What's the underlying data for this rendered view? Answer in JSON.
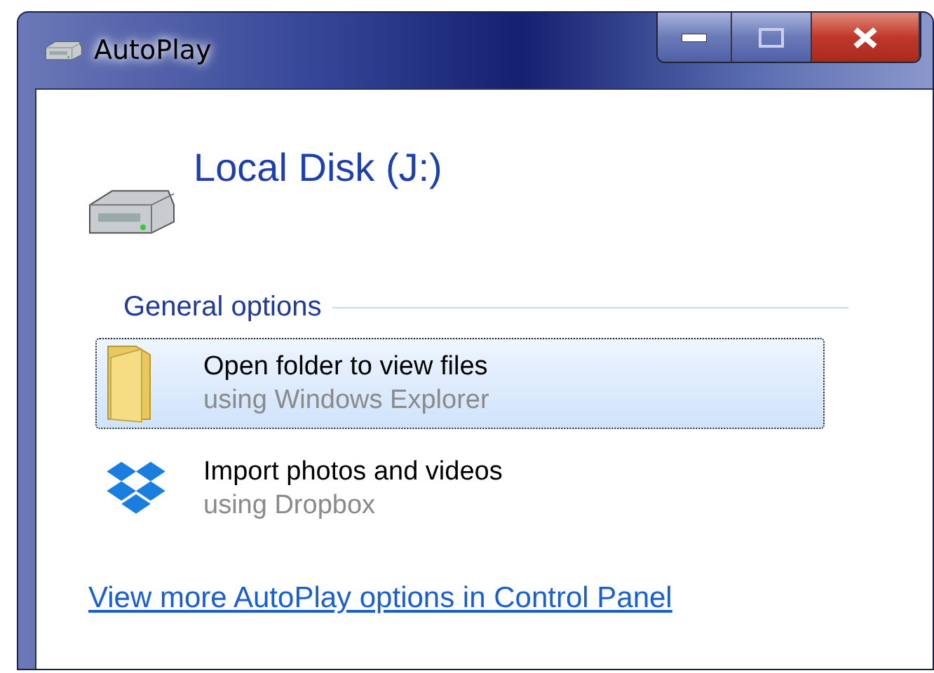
{
  "window": {
    "title": "AutoPlay"
  },
  "device": {
    "name": "Local Disk (J:)"
  },
  "section": {
    "title": "General options"
  },
  "options": [
    {
      "kind": "folder",
      "title": "Open folder to view files",
      "subtitle": "using Windows Explorer",
      "selected": true
    },
    {
      "kind": "dropbox",
      "title": "Import photos and videos",
      "subtitle": "using Dropbox",
      "selected": false
    }
  ],
  "link": "View more AutoPlay options in Control Panel"
}
